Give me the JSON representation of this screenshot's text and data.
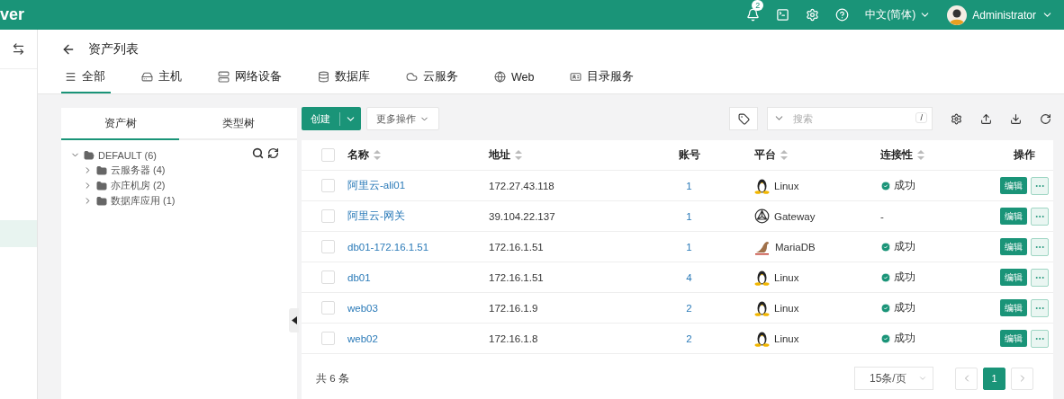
{
  "brand": "ver",
  "header": {
    "notifications": "2",
    "language": "中文(简体)",
    "user": "Administrator"
  },
  "sidebar": {
    "items": [
      {
        "selected": true
      }
    ]
  },
  "page": {
    "title": "资产列表"
  },
  "tabs": [
    {
      "label": "全部",
      "selected": true
    },
    {
      "label": "主机",
      "selected": false
    },
    {
      "label": "网络设备",
      "selected": false
    },
    {
      "label": "数据库",
      "selected": false
    },
    {
      "label": "云服务",
      "selected": false
    },
    {
      "label": "Web",
      "selected": false
    },
    {
      "label": "目录服务",
      "selected": false
    }
  ],
  "tree": {
    "tabs": [
      {
        "label": "资产树",
        "selected": true
      },
      {
        "label": "类型树",
        "selected": false
      }
    ],
    "root": {
      "label": "DEFAULT (6)",
      "expanded": true,
      "children": [
        {
          "label": "云服务器 (4)",
          "expanded": false
        },
        {
          "label": "亦庄机房 (2)",
          "expanded": false
        },
        {
          "label": "数据库应用 (1)",
          "expanded": false
        }
      ]
    }
  },
  "toolbar": {
    "create": "创建",
    "more": "更多操作",
    "search_placeholder": "搜索",
    "shortcut": "/"
  },
  "table": {
    "all_checked": false,
    "columns": [
      {
        "label": "名称",
        "sortable": true
      },
      {
        "label": "地址",
        "sortable": true
      },
      {
        "label": "账号",
        "sortable": false
      },
      {
        "label": "平台",
        "sortable": true
      },
      {
        "label": "连接性",
        "sortable": true
      },
      {
        "label": "操作",
        "sortable": false
      }
    ],
    "rows": [
      {
        "checked": false,
        "name": "阿里云-ali01",
        "address": "172.27.43.118",
        "accounts": "1",
        "platform": {
          "kind": "linux",
          "label": "Linux"
        },
        "connectivity": {
          "ok": true,
          "label": "成功"
        },
        "action": "编辑"
      },
      {
        "checked": false,
        "name": "阿里云-网关",
        "address": "39.104.22.137",
        "accounts": "1",
        "platform": {
          "kind": "gateway",
          "label": "Gateway"
        },
        "connectivity": {
          "ok": false,
          "label": "-"
        },
        "action": "编辑"
      },
      {
        "checked": false,
        "name": "db01-172.16.1.51",
        "address": "172.16.1.51",
        "accounts": "1",
        "platform": {
          "kind": "mariadb",
          "label": "MariaDB"
        },
        "connectivity": {
          "ok": true,
          "label": "成功"
        },
        "action": "编辑"
      },
      {
        "checked": false,
        "name": "db01",
        "address": "172.16.1.51",
        "accounts": "4",
        "platform": {
          "kind": "linux",
          "label": "Linux"
        },
        "connectivity": {
          "ok": true,
          "label": "成功"
        },
        "action": "编辑"
      },
      {
        "checked": false,
        "name": "web03",
        "address": "172.16.1.9",
        "accounts": "2",
        "platform": {
          "kind": "linux",
          "label": "Linux"
        },
        "connectivity": {
          "ok": true,
          "label": "成功"
        },
        "action": "编辑"
      },
      {
        "checked": false,
        "name": "web02",
        "address": "172.16.1.8",
        "accounts": "2",
        "platform": {
          "kind": "linux",
          "label": "Linux"
        },
        "connectivity": {
          "ok": true,
          "label": "成功"
        },
        "action": "编辑"
      }
    ]
  },
  "pagination": {
    "total": "共 6 条",
    "page_size": "15条/页",
    "pages": [
      {
        "label": "1",
        "selected": true
      }
    ]
  }
}
